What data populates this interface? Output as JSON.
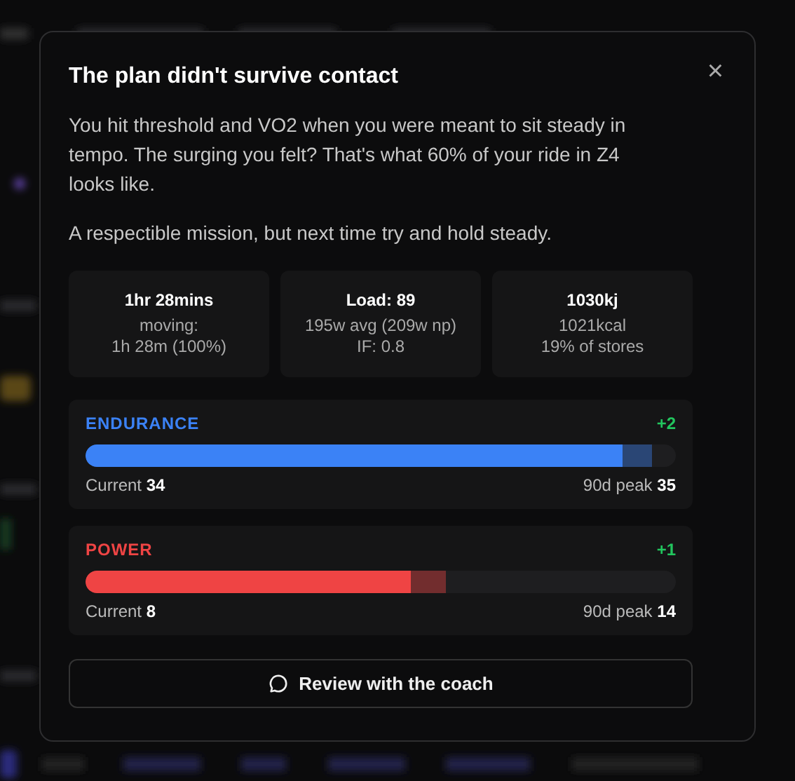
{
  "dialog": {
    "title": "The plan didn't survive contact",
    "close": "×",
    "paragraphs": [
      "You hit threshold and VO2 when you were meant to sit steady in tempo. The surging you felt? That's what 60% of your ride in Z4 looks like.",
      "A respectible mission, but next time try and hold steady."
    ],
    "stats": [
      {
        "value": "1hr 28mins",
        "lines": [
          "moving:",
          "1h 28m (100%)"
        ]
      },
      {
        "value": "Load: 89",
        "lines": [
          "195w avg (209w np)",
          "IF: 0.8"
        ]
      },
      {
        "value": "1030kj",
        "lines": [
          "1021kcal",
          "19% of stores"
        ]
      }
    ],
    "skills": [
      {
        "name": "ENDURANCE",
        "color": "#3b82f6",
        "change": "+2",
        "level": 0.91,
        "peak_segment": {
          "level": 0.96
        },
        "current_label": "Current",
        "current": "34",
        "peak_label": "90d peak",
        "peak": "35"
      },
      {
        "name": "POWER",
        "color": "#ef4444",
        "change": "+1",
        "level": 0.55,
        "peak_segment": {
          "level": 0.61
        },
        "current_label": "Current",
        "current": "8",
        "peak_label": "90d peak",
        "peak": "14"
      }
    ],
    "action": "Review with the coach"
  }
}
